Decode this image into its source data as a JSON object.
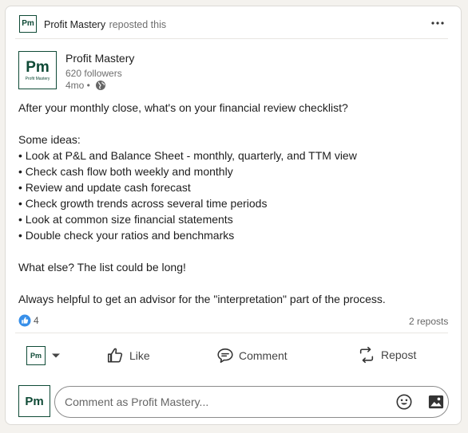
{
  "header": {
    "logo_text": "Pm",
    "name": "Profit Mastery",
    "reposted_text": "reposted this",
    "more_icon": "more-horizontal-icon"
  },
  "author": {
    "logo_text": "Pm",
    "logo_subtext": "Profit Mastery",
    "name": "Profit Mastery",
    "followers": "620 followers",
    "time": "4mo •",
    "visibility_icon": "globe-icon"
  },
  "post": {
    "lines": [
      "After your monthly close, what's on your financial review checklist?",
      "",
      "Some ideas:",
      "• Look at P&L and Balance Sheet - monthly, quarterly, and TTM view",
      "• Check cash flow both weekly and monthly",
      "• Review and update cash forecast",
      "• Check growth trends across several time periods",
      "• Look at common size financial statements",
      "• Double check your ratios and benchmarks",
      "",
      "What else? The list could be long!",
      "",
      "Always helpful to get an advisor for the \"interpretation\" part of the process."
    ]
  },
  "social": {
    "reaction_icon": "like-reaction-icon",
    "reaction_count": "4",
    "reposts": "2 reposts"
  },
  "actions": {
    "actor_logo_text": "Pm",
    "like_label": "Like",
    "comment_label": "Comment",
    "repost_label": "Repost"
  },
  "comment": {
    "logo_text": "Pm",
    "placeholder": "Comment as Profit Mastery...",
    "emoji_icon": "emoji-icon",
    "image_icon": "image-icon"
  },
  "colors": {
    "brand": "#0f4a36",
    "reaction_blue": "#378fe9",
    "background": "#f4f2ee"
  }
}
